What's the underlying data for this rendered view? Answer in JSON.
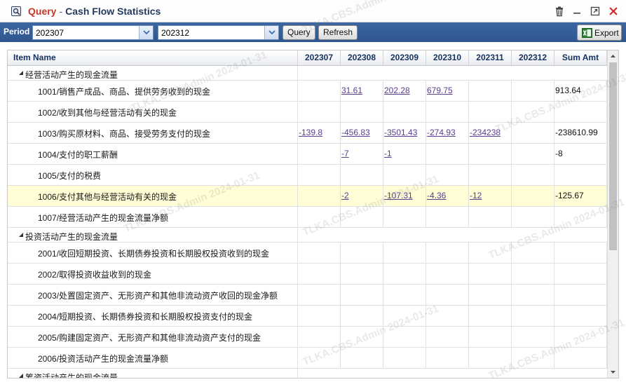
{
  "window": {
    "title_prefix": "Query",
    "title_separator": "-",
    "title": "Cash Flow Statistics"
  },
  "toolbar": {
    "period_label": "Period",
    "period_from": "202307",
    "period_to": "202312",
    "query_label": "Query",
    "refresh_label": "Refresh",
    "export_label": "Export"
  },
  "grid": {
    "columns": [
      "Item Name",
      "202307",
      "202308",
      "202309",
      "202310",
      "202311",
      "202312",
      "Sum Amt"
    ],
    "rows": [
      {
        "type": "group",
        "name": "经营活动产生的现金流量",
        "values": [
          "",
          "",
          "",
          "",
          "",
          ""
        ],
        "sum": ""
      },
      {
        "type": "item",
        "name": "1001/销售产成品、商品、提供劳务收到的现金",
        "values": [
          "",
          "31.61",
          "202.28",
          "679.75",
          "",
          ""
        ],
        "sum": "913.64"
      },
      {
        "type": "item",
        "name": "1002/收到其他与经营活动有关的现金",
        "values": [
          "",
          "",
          "",
          "",
          "",
          ""
        ],
        "sum": ""
      },
      {
        "type": "item",
        "name": "1003/购买原材料、商品、接受劳务支付的现金",
        "values": [
          "-139.8",
          "-456.83",
          "-3501.43",
          "-274.93",
          "-234238",
          ""
        ],
        "sum": "-238610.99"
      },
      {
        "type": "item",
        "name": "1004/支付的职工薪酬",
        "values": [
          "",
          "-7",
          "-1",
          "",
          "",
          ""
        ],
        "sum": "-8"
      },
      {
        "type": "item",
        "name": "1005/支付的税费",
        "values": [
          "",
          "",
          "",
          "",
          "",
          ""
        ],
        "sum": ""
      },
      {
        "type": "item",
        "highlight": true,
        "name": "1006/支付其他与经营活动有关的现金",
        "values": [
          "",
          "-2",
          "-107.31",
          "-4.36",
          "-12",
          ""
        ],
        "sum": "-125.67"
      },
      {
        "type": "item",
        "name": "1007/经营活动产生的现金流量净额",
        "values": [
          "",
          "",
          "",
          "",
          "",
          ""
        ],
        "sum": ""
      },
      {
        "type": "group",
        "name": "投资活动产生的现金流量",
        "values": [
          "",
          "",
          "",
          "",
          "",
          ""
        ],
        "sum": ""
      },
      {
        "type": "item",
        "name": "2001/收回短期投资、长期债券投资和长期股权投资收到的现金",
        "values": [
          "",
          "",
          "",
          "",
          "",
          ""
        ],
        "sum": ""
      },
      {
        "type": "item",
        "name": "2002/取得投资收益收到的现金",
        "values": [
          "",
          "",
          "",
          "",
          "",
          ""
        ],
        "sum": ""
      },
      {
        "type": "item",
        "name": "2003/处置固定资产、无形资产和其他非流动资产收回的现金净额",
        "values": [
          "",
          "",
          "",
          "",
          "",
          ""
        ],
        "sum": ""
      },
      {
        "type": "item",
        "name": "2004/短期投资、长期债券投资和长期股权投资支付的现金",
        "values": [
          "",
          "",
          "",
          "",
          "",
          ""
        ],
        "sum": ""
      },
      {
        "type": "item",
        "name": "2005/购建固定资产、无形资产和其他非流动资产支付的现金",
        "values": [
          "",
          "",
          "",
          "",
          "",
          ""
        ],
        "sum": ""
      },
      {
        "type": "item",
        "name": "2006/投资活动产生的现金流量净额",
        "values": [
          "",
          "",
          "",
          "",
          "",
          ""
        ],
        "sum": ""
      },
      {
        "type": "group",
        "name": "筹资活动产生的现金流量",
        "values": [
          "",
          "",
          "",
          "",
          "",
          ""
        ],
        "sum": ""
      }
    ]
  },
  "watermark": "TLKA.CBS.Admin 2024-01-31",
  "colors": {
    "toolbar": "#2e558e",
    "header_text": "#15315e",
    "link": "#5b3d8f",
    "highlight_row": "#fffed6",
    "title_accent": "#c0392b"
  }
}
